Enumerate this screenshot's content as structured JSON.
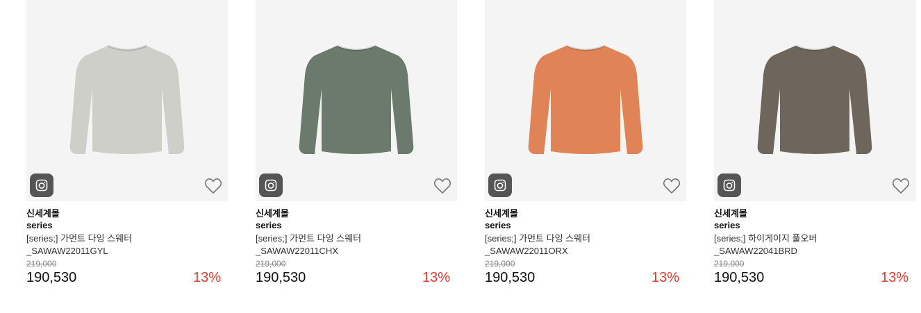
{
  "products": [
    {
      "mall": "신세계몰",
      "brand": "series",
      "name_line1": "[series;] 가먼트 다잉 스웨터",
      "name_line2": "_SAWAW22011GYL",
      "original_price": "219,000",
      "price": "190,530",
      "discount": "13%",
      "color": "#cfcfca",
      "icon_camera": "camera-icon",
      "icon_wish": "heart-icon"
    },
    {
      "mall": "신세계몰",
      "brand": "series",
      "name_line1": "[series;] 가먼트 다잉 스웨터",
      "name_line2": "_SAWAW22011CHX",
      "original_price": "219,000",
      "price": "190,530",
      "discount": "13%",
      "color": "#6b7a6c",
      "icon_camera": "camera-icon",
      "icon_wish": "heart-icon"
    },
    {
      "mall": "신세계몰",
      "brand": "series",
      "name_line1": "[series;] 가먼트 다잉 스웨터",
      "name_line2": "_SAWAW22011ORX",
      "original_price": "219,000",
      "price": "190,530",
      "discount": "13%",
      "color": "#e08356",
      "icon_camera": "camera-icon",
      "icon_wish": "heart-icon"
    },
    {
      "mall": "신세계몰",
      "brand": "series",
      "name_line1": "[series;] 하이게이지 풀오버",
      "name_line2": "_SAWAW22041BRD",
      "original_price": "219,000",
      "price": "190,530",
      "discount": "13%",
      "color": "#6e655d",
      "icon_camera": "camera-icon",
      "icon_wish": "heart-icon"
    }
  ],
  "colors": {
    "discount": "#e8372c",
    "thumb_bg": "#f4f4f4",
    "camera_bg": "#555555"
  }
}
